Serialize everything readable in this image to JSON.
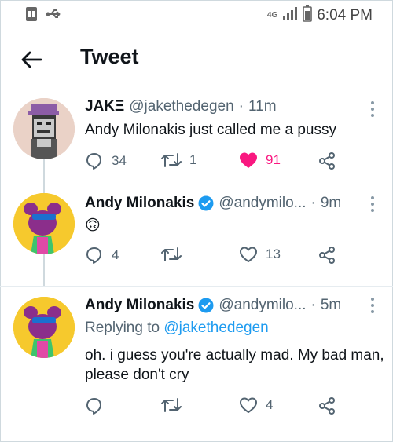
{
  "status_bar": {
    "time": "6:04 PM",
    "network": "4G"
  },
  "header": {
    "title": "Tweet"
  },
  "tweets": [
    {
      "name": "JAKΞ",
      "handle": "@jakethedegen",
      "time": "11m",
      "text": "Andy Milonakis just called me a pussy",
      "replies": "34",
      "retweets": "1",
      "likes": "91",
      "liked": true
    },
    {
      "name": "Andy Milonakis",
      "handle": "@andymilo...",
      "time": "9m",
      "text": "🙃",
      "replies": "4",
      "retweets": "",
      "likes": "13",
      "verified": true
    },
    {
      "name": "Andy Milonakis",
      "handle": "@andymilo...",
      "time": "5m",
      "reply_prefix": "Replying to",
      "reply_target": "@jakethedegen",
      "text": "oh. i guess you're actually mad. My bad man, please don't cry",
      "replies": "",
      "retweets": "",
      "likes": "4",
      "verified": true
    }
  ],
  "colors": {
    "like_active": "#f91880",
    "link": "#1d9bf0",
    "verified": "#1d9bf0",
    "muted": "#536471"
  },
  "separator": "·"
}
